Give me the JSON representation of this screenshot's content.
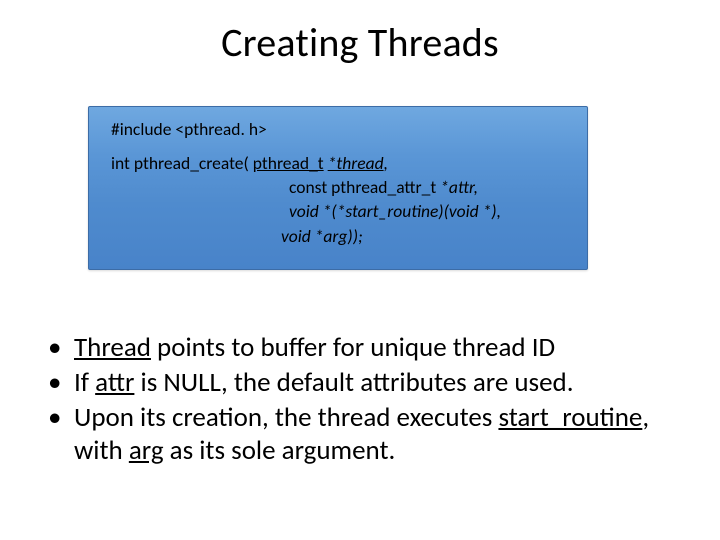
{
  "title": "Creating Threads",
  "code": {
    "include": "#include <pthread. h>",
    "line1_a": "int pthread_create( ",
    "line1_b": "pthread_t",
    "line1_c": "*thread",
    "line1_d": ",",
    "line2_a": "const pthread_attr_t ",
    "line2_b": "*attr,",
    "line3": "void *(*start_routine)(void *),",
    "line4": "void *arg));"
  },
  "bullets": [
    {
      "pre": "",
      "u1": "Thread",
      "mid": "  points to buffer for unique thread ID",
      "u2": "",
      "post": ""
    },
    {
      "pre": "If ",
      "u1": "attr",
      "mid": " is NULL, the default attributes are used.",
      "u2": "",
      "post": ""
    },
    {
      "pre": "Upon its creation, the thread executes ",
      "u1": "start_routine",
      "mid": ", with ",
      "u2": "arg",
      "post": " as its sole argument."
    }
  ]
}
